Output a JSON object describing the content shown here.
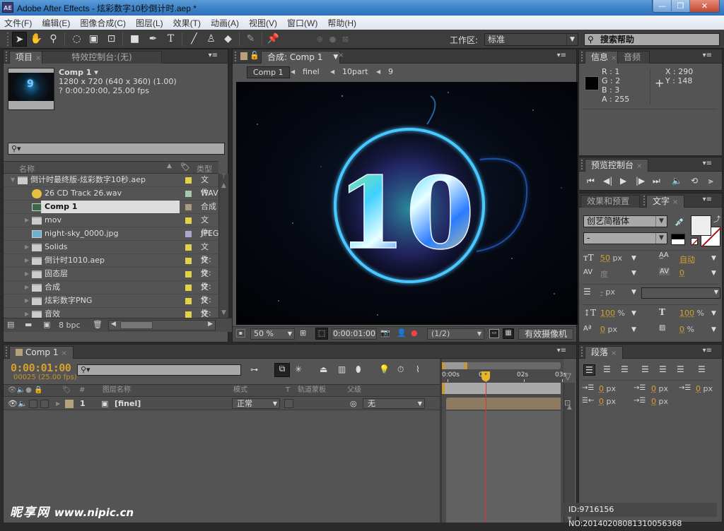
{
  "window": {
    "app_icon": "AE",
    "title": "Adobe After Effects - 炫彩数字10秒倒计时.aep *",
    "minimize": "—",
    "restore": "❐",
    "close": "✕"
  },
  "menu": [
    "文件(F)",
    "编辑(E)",
    "图像合成(C)",
    "图层(L)",
    "效果(T)",
    "动画(A)",
    "视图(V)",
    "窗口(W)",
    "帮助(H)"
  ],
  "toolbar": {
    "workspace_label": "工作区:",
    "workspace_value": "标准",
    "search_help": "搜索帮助"
  },
  "project": {
    "tab_project": "项目",
    "tab_effects": "特效控制台:(无)",
    "comp_name": "Comp 1 ▾",
    "comp_size": "1280 x 720  (640 x 360) (1.00)",
    "comp_duration": "? 0:00:20:00, 25.00 fps",
    "search_placeholder": "",
    "col_name": "名称",
    "col_type": "类型",
    "items": [
      {
        "name": "倒计时最终版-炫彩数字10秒.aep",
        "type": "文件:",
        "label_color": "#e2d24a",
        "kind": "folder",
        "expanded": true,
        "indent": 0
      },
      {
        "name": "26 CD Track 26.wav",
        "type": "WAV",
        "label_color": "#a9c8b0",
        "kind": "audio",
        "indent": 1
      },
      {
        "name": "Comp 1",
        "type": "合成",
        "label_color": "#a89a7e",
        "kind": "comp",
        "indent": 1,
        "selected": true
      },
      {
        "name": "mov",
        "type": "文件:",
        "label_color": "#e2d24a",
        "kind": "folder",
        "indent": 1
      },
      {
        "name": "night-sky_0000.jpg",
        "type": "JPEG",
        "label_color": "#a9a9cc",
        "kind": "image",
        "indent": 1
      },
      {
        "name": "Solids",
        "type": "文件:",
        "label_color": "#e2d24a",
        "kind": "folder",
        "indent": 1
      },
      {
        "name": "倒计时1010.aep",
        "type": "文件:",
        "label_color": "#e2d24a",
        "kind": "folder",
        "indent": 1
      },
      {
        "name": "固态层",
        "type": "文件:",
        "label_color": "#e2d24a",
        "kind": "folder",
        "indent": 1
      },
      {
        "name": "合成",
        "type": "文件:",
        "label_color": "#e2d24a",
        "kind": "folder",
        "indent": 1
      },
      {
        "name": "炫彩数字PNG",
        "type": "文件:",
        "label_color": "#e2d24a",
        "kind": "folder",
        "indent": 1
      },
      {
        "name": "音效",
        "type": "文件:",
        "label_color": "#e2d24a",
        "kind": "folder",
        "indent": 1
      }
    ],
    "bpc": "8 bpc"
  },
  "composition": {
    "tab_label": "合成: Comp 1",
    "breadcrumbs": [
      "Comp 1",
      "finel",
      "10part",
      "9"
    ],
    "preview_number": "10",
    "zoom": "50 %",
    "timecode": "0:00:01:00",
    "resolution": "(1/2)",
    "camera": "有效摄像机"
  },
  "info": {
    "tab_info": "信息",
    "tab_audio": "音频",
    "r": "R : 1",
    "g": "G : 2",
    "b": "B : 3",
    "a": "A : 255",
    "x": "X : 290",
    "y": "Y : 148",
    "swatch_color": "#010203"
  },
  "preview": {
    "tab_label": "预览控制台"
  },
  "character": {
    "tab_effects": "效果和预置",
    "tab_text": "文字",
    "font": "创艺简楷体",
    "style": "-",
    "size": "50",
    "size_unit": "px",
    "leading": "自动",
    "kerning": "度",
    "tracking": "0",
    "stroke": "-",
    "stroke_unit": "px",
    "vscale": "100",
    "hscale": "100",
    "baseline": "0",
    "baseline_unit": "px",
    "tsume": "0",
    "percent": "%"
  },
  "paragraph": {
    "tab_label": "段落",
    "indent_left": "0",
    "indent_first": "0",
    "indent_right": "0",
    "space_before": "0",
    "space_after": "0",
    "unit": "px"
  },
  "timeline": {
    "tab_label": "Comp 1",
    "current_time": "0:00:01:00",
    "frames": "00025 (25.00 fps)",
    "col_num": "#",
    "col_layer_name": "图层名称",
    "col_mode": "模式",
    "col_t": "T",
    "col_trkmat": "轨道蒙板",
    "col_parent": "父级",
    "ruler": [
      "0:00s",
      "01s",
      "02s",
      "03s"
    ],
    "current_time_sec": 1,
    "layers": [
      {
        "index": "1",
        "name": "[finel]",
        "mode": "正常",
        "parent": "无"
      }
    ]
  },
  "watermark": {
    "site_cn": "昵享网",
    "site_url": "www.nipic.cn",
    "id_text": "ID:9716156 NO:20140208081310056368"
  }
}
